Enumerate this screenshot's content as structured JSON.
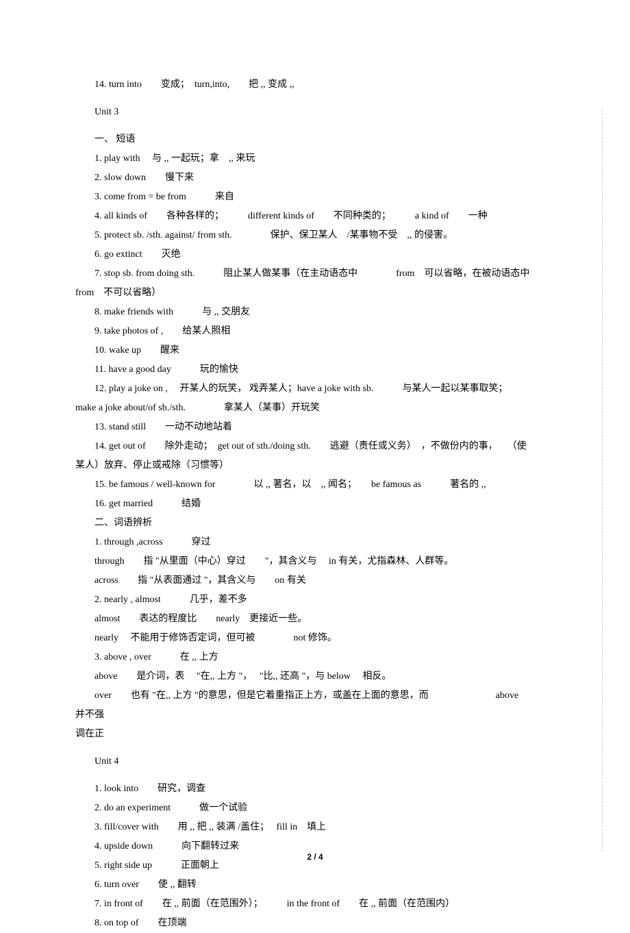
{
  "lines": [
    {
      "t": "14. turn into　　变成；　turn,into,　　把 ,, 变成 ,,",
      "i": true
    },
    {
      "spacer": true
    },
    {
      "t": "Unit 3",
      "i": true
    },
    {
      "spacer": true
    },
    {
      "t": "一、 短语",
      "i": true
    },
    {
      "t": "1. play with　 与 ,, 一起玩；拿　,, 来玩",
      "i": true
    },
    {
      "t": "2. slow down　　慢下来",
      "i": true
    },
    {
      "t": "3. come from = be from　　　来自",
      "i": true
    },
    {
      "t": "4. all kinds of　　各种各样的；　　　different kinds of　　不同种类的；　　　a kind of　　一种",
      "i": true
    },
    {
      "t": "5. protect sb. /sth. against/ from sth.　　　　保护、保卫某人　/某事物不受　,, 的侵害。",
      "i": true
    },
    {
      "t": "6. go extinct　　灭绝",
      "i": true
    },
    {
      "t": "7. stop sb. from doing sth.　　　阻止某人做某事（在主动语态中　　　　from　可以省略，在被动语态中",
      "i": true
    },
    {
      "t": "from　不可以省略）",
      "i": false
    },
    {
      "t": "8. make friends with　　　与 ,, 交朋友",
      "i": true
    },
    {
      "t": "9. take photos of ,　　给某人照相",
      "i": true
    },
    {
      "t": "10. wake up　　醒来",
      "i": true
    },
    {
      "t": "11. have a good day　　　玩的愉快",
      "i": true
    },
    {
      "t": "12.  play a joke on ,　 开某人的玩笑，  戏弄某人；have a joke with sb.　　　与某人一起以某事取笑；",
      "i": true
    },
    {
      "t": "make a joke about/of sb./sth.　　　　拿某人（某事）开玩笑",
      "i": false
    },
    {
      "t": "13. stand still　　一动不动地站着",
      "i": true
    },
    {
      "t": "14. get out of　　除外走动；　get out of sth./doing sth.　　逃避（责任或义务）　，不做份内的事，　　（使",
      "i": true
    },
    {
      "t": "某人）放弃、停止或戒除（习惯等）",
      "i": false
    },
    {
      "t": "15. be famous / well-known for　　　　以 ,, 著名，以　,, 闻名；　　be famous as　　　著名的 ,,",
      "i": true
    },
    {
      "t": "16. get married　　　结婚",
      "i": true
    },
    {
      "t": "二、词语辨析",
      "i": true
    },
    {
      "t": "1. through ,across　　　穿过",
      "i": true
    },
    {
      "t": "through　　指 \"从里面（中心）穿过　　\"，其含义与　 in 有关，尤指森林、人群等。",
      "i": true
    },
    {
      "t": "across　　指 \"从表面通过 \"，其含义与　　on  有关",
      "i": true
    },
    {
      "t": "2. nearly , almost　　　几乎，差不多",
      "i": true
    },
    {
      "t": "almost　　表达的程度比　　nearly　更接近一些。",
      "i": true
    },
    {
      "t": "nearly　 不能用于修饰否定词，但可被　　　　not  修饰。",
      "i": true
    },
    {
      "t": "3. above , over　　　在 ,, 上方",
      "i": true
    },
    {
      "t": "above　　是介词，表　 \"在,, 上方 \"，　 \"比,, 还高 \"，与  below　 相反。",
      "i": true
    },
    {
      "t": "over　　也有 \"在,, 上方 \"的意思，但是它着重指正上方，或盖在上面的意思，而　　　　　　　above　　并不强",
      "i": true
    },
    {
      "t": "调在正",
      "i": false
    },
    {
      "spacer": true
    },
    {
      "t": "Unit 4",
      "i": true
    },
    {
      "spacer": true
    },
    {
      "t": "1. look into　　研究，调查",
      "i": true
    },
    {
      "t": "2. do an experiment　　　做一个试验",
      "i": true
    },
    {
      "t": "3. fill/cover with　　用 ,, 把 ,, 装满 /盖住；　 fill in　填上",
      "i": true
    },
    {
      "t": "4. upside down　　　向下翻转过来",
      "i": true
    },
    {
      "t": "5. right side up　　　正面朝上",
      "i": true
    },
    {
      "t": "6. turn over　　使 ,, 翻转",
      "i": true
    },
    {
      "t": "7. in front of　　在 ,, 前面（在范围外）；　　　in the front of　　在 ,, 前面（在范围内）",
      "i": true
    },
    {
      "t": "8. on top of　　在顶端",
      "i": true
    }
  ],
  "footer": "2 / 4"
}
